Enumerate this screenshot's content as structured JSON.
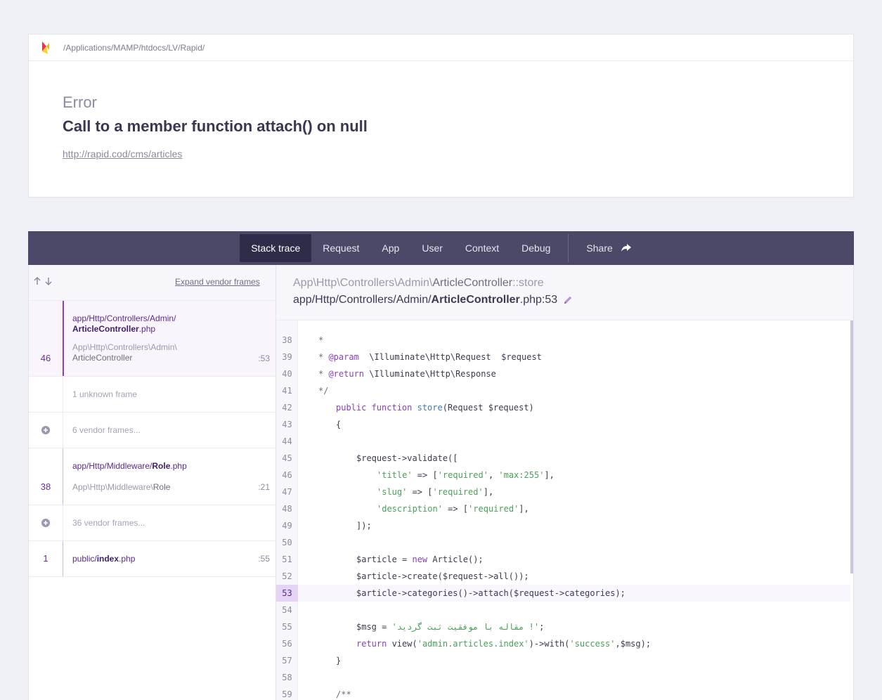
{
  "header": {
    "app_path": "/Applications/MAMP/htdocs/LV/Rapid/",
    "error_class": "Error",
    "error_message": "Call to a member function attach() on null",
    "url": "http://rapid.cod/cms/articles"
  },
  "tabs": {
    "items": [
      "Stack trace",
      "Request",
      "App",
      "User",
      "Context",
      "Debug"
    ],
    "share": "Share",
    "active": "Stack trace"
  },
  "frames_panel": {
    "expand_vendor": "Expand vendor frames",
    "frames": [
      {
        "number": "46",
        "file_dir": "app/Http/Controllers/Admin/",
        "file_name": "ArticleController",
        "file_ext": ".php",
        "class_ns": "App\\Http\\Controllers\\Admin\\",
        "class_name": "ArticleController",
        "line": ":53"
      },
      {
        "text": "1 unknown frame"
      },
      {
        "text": "6 vendor frames..."
      },
      {
        "number": "38",
        "file_dir": "app/Http/Middleware/",
        "file_name": "Role",
        "file_ext": ".php",
        "class_ns": "App\\Http\\Middleware\\",
        "class_name": "Role",
        "line": ":21"
      },
      {
        "text": "36 vendor frames..."
      },
      {
        "number": "1",
        "file_dir": "public/",
        "file_name": "index",
        "file_ext": ".php",
        "line": ":55"
      }
    ]
  },
  "code": {
    "class_ns": "App\\Http\\Controllers\\Admin\\",
    "class_name": "ArticleController",
    "method": "::store",
    "file_dir": "app/Http/Controllers/Admin/",
    "file_name": "ArticleController",
    "file_suffix": ".php:53",
    "highlighted_line": 53,
    "line_numbers": [
      "38",
      "39",
      "40",
      "41",
      "42",
      "43",
      "44",
      "45",
      "46",
      "47",
      "48",
      "49",
      "50",
      "51",
      "52",
      "53",
      "54",
      "55",
      "56",
      "57",
      "58",
      "59"
    ],
    "lines": {
      "l38": "*",
      "l39_a": "* ",
      "l39_b": "@param",
      "l39_c": "  \\Illuminate\\Http\\Request  $request",
      "l40_a": "* ",
      "l40_b": "@return",
      "l40_c": " \\Illuminate\\Http\\Response",
      "l41": "*/",
      "l42_a": "public function",
      "l42_b": "store",
      "l42_c": "(Request $request)",
      "l43": "{",
      "l45": "$request->validate([",
      "l46_a": "'title'",
      "l46_b": " => [",
      "l46_c": "'required'",
      "l46_d": ", ",
      "l46_e": "'max:255'",
      "l46_f": "],",
      "l47_a": "'slug'",
      "l47_b": " => [",
      "l47_c": "'required'",
      "l47_d": "],",
      "l48_a": "'description'",
      "l48_b": " => [",
      "l48_c": "'required'",
      "l48_d": "],",
      "l49": "]);",
      "l51_a": "$article = ",
      "l51_b": "new",
      "l51_c": " Article();",
      "l52": "$article->create($request->all());",
      "l53": "$article->categories()->attach($request->categories);",
      "l55_a": "$msg = ",
      "l55_b": "'مقاله با موفقیت ثبت گردید !'",
      "l55_c": ";",
      "l56_a": "return",
      "l56_b": " view(",
      "l56_c": "'admin.articles.index'",
      "l56_d": ")->with(",
      "l56_e": "'success'",
      "l56_f": ",$msg);",
      "l57": "}",
      "l59": "/**"
    }
  },
  "colors": {
    "tab_bar": "#4b4868",
    "tab_active": "#2f2c4a",
    "accent_purple": "#8a3fbe",
    "string_green": "#4aa05a",
    "function_blue": "#3b7ac2"
  }
}
